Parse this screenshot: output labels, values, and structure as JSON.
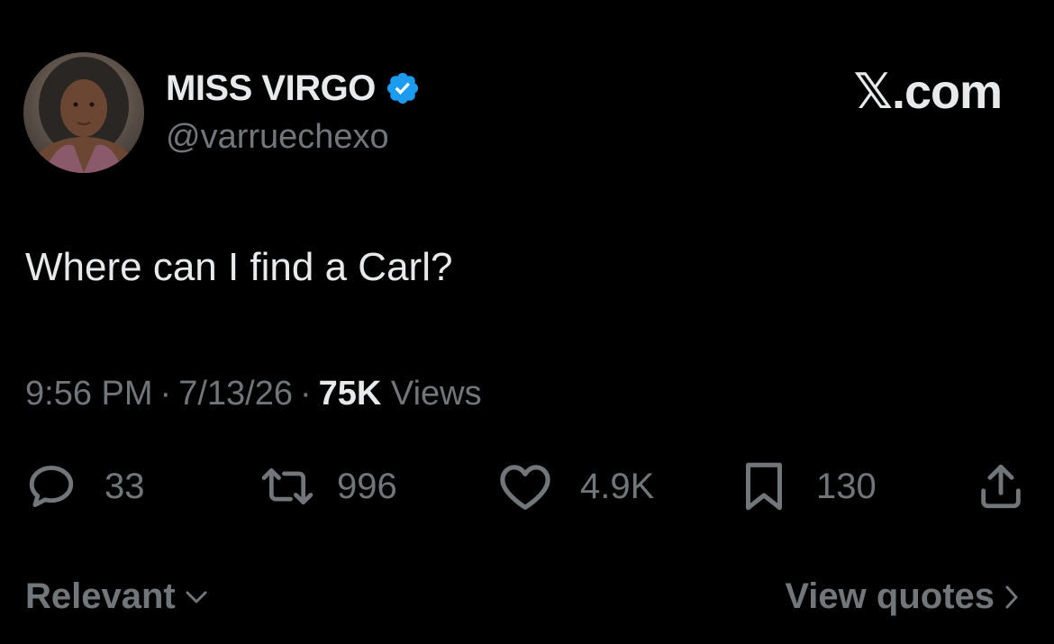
{
  "author": {
    "display_name": "MISS VIRGO",
    "handle": "@varruechexo",
    "verified": true,
    "avatar_icon": "profile-photo",
    "verified_icon": "verified-badge-icon"
  },
  "site": {
    "logo_text": "𝕏.com"
  },
  "tweet": {
    "text": "Where can I find a Carl?"
  },
  "meta": {
    "time": "9:56 PM",
    "separator": "·",
    "date": "7/13/26",
    "views_count": "75K",
    "views_label": "Views"
  },
  "actions": {
    "replies": "33",
    "reposts": "996",
    "likes": "4.9K",
    "bookmarks": "130"
  },
  "footer": {
    "sort_label": "Relevant",
    "view_quotes_label": "View quotes"
  },
  "colors": {
    "background": "#000000",
    "primary_text": "#e7e9ea",
    "secondary_text": "#71767b",
    "verified_blue": "#1d9bf0"
  }
}
